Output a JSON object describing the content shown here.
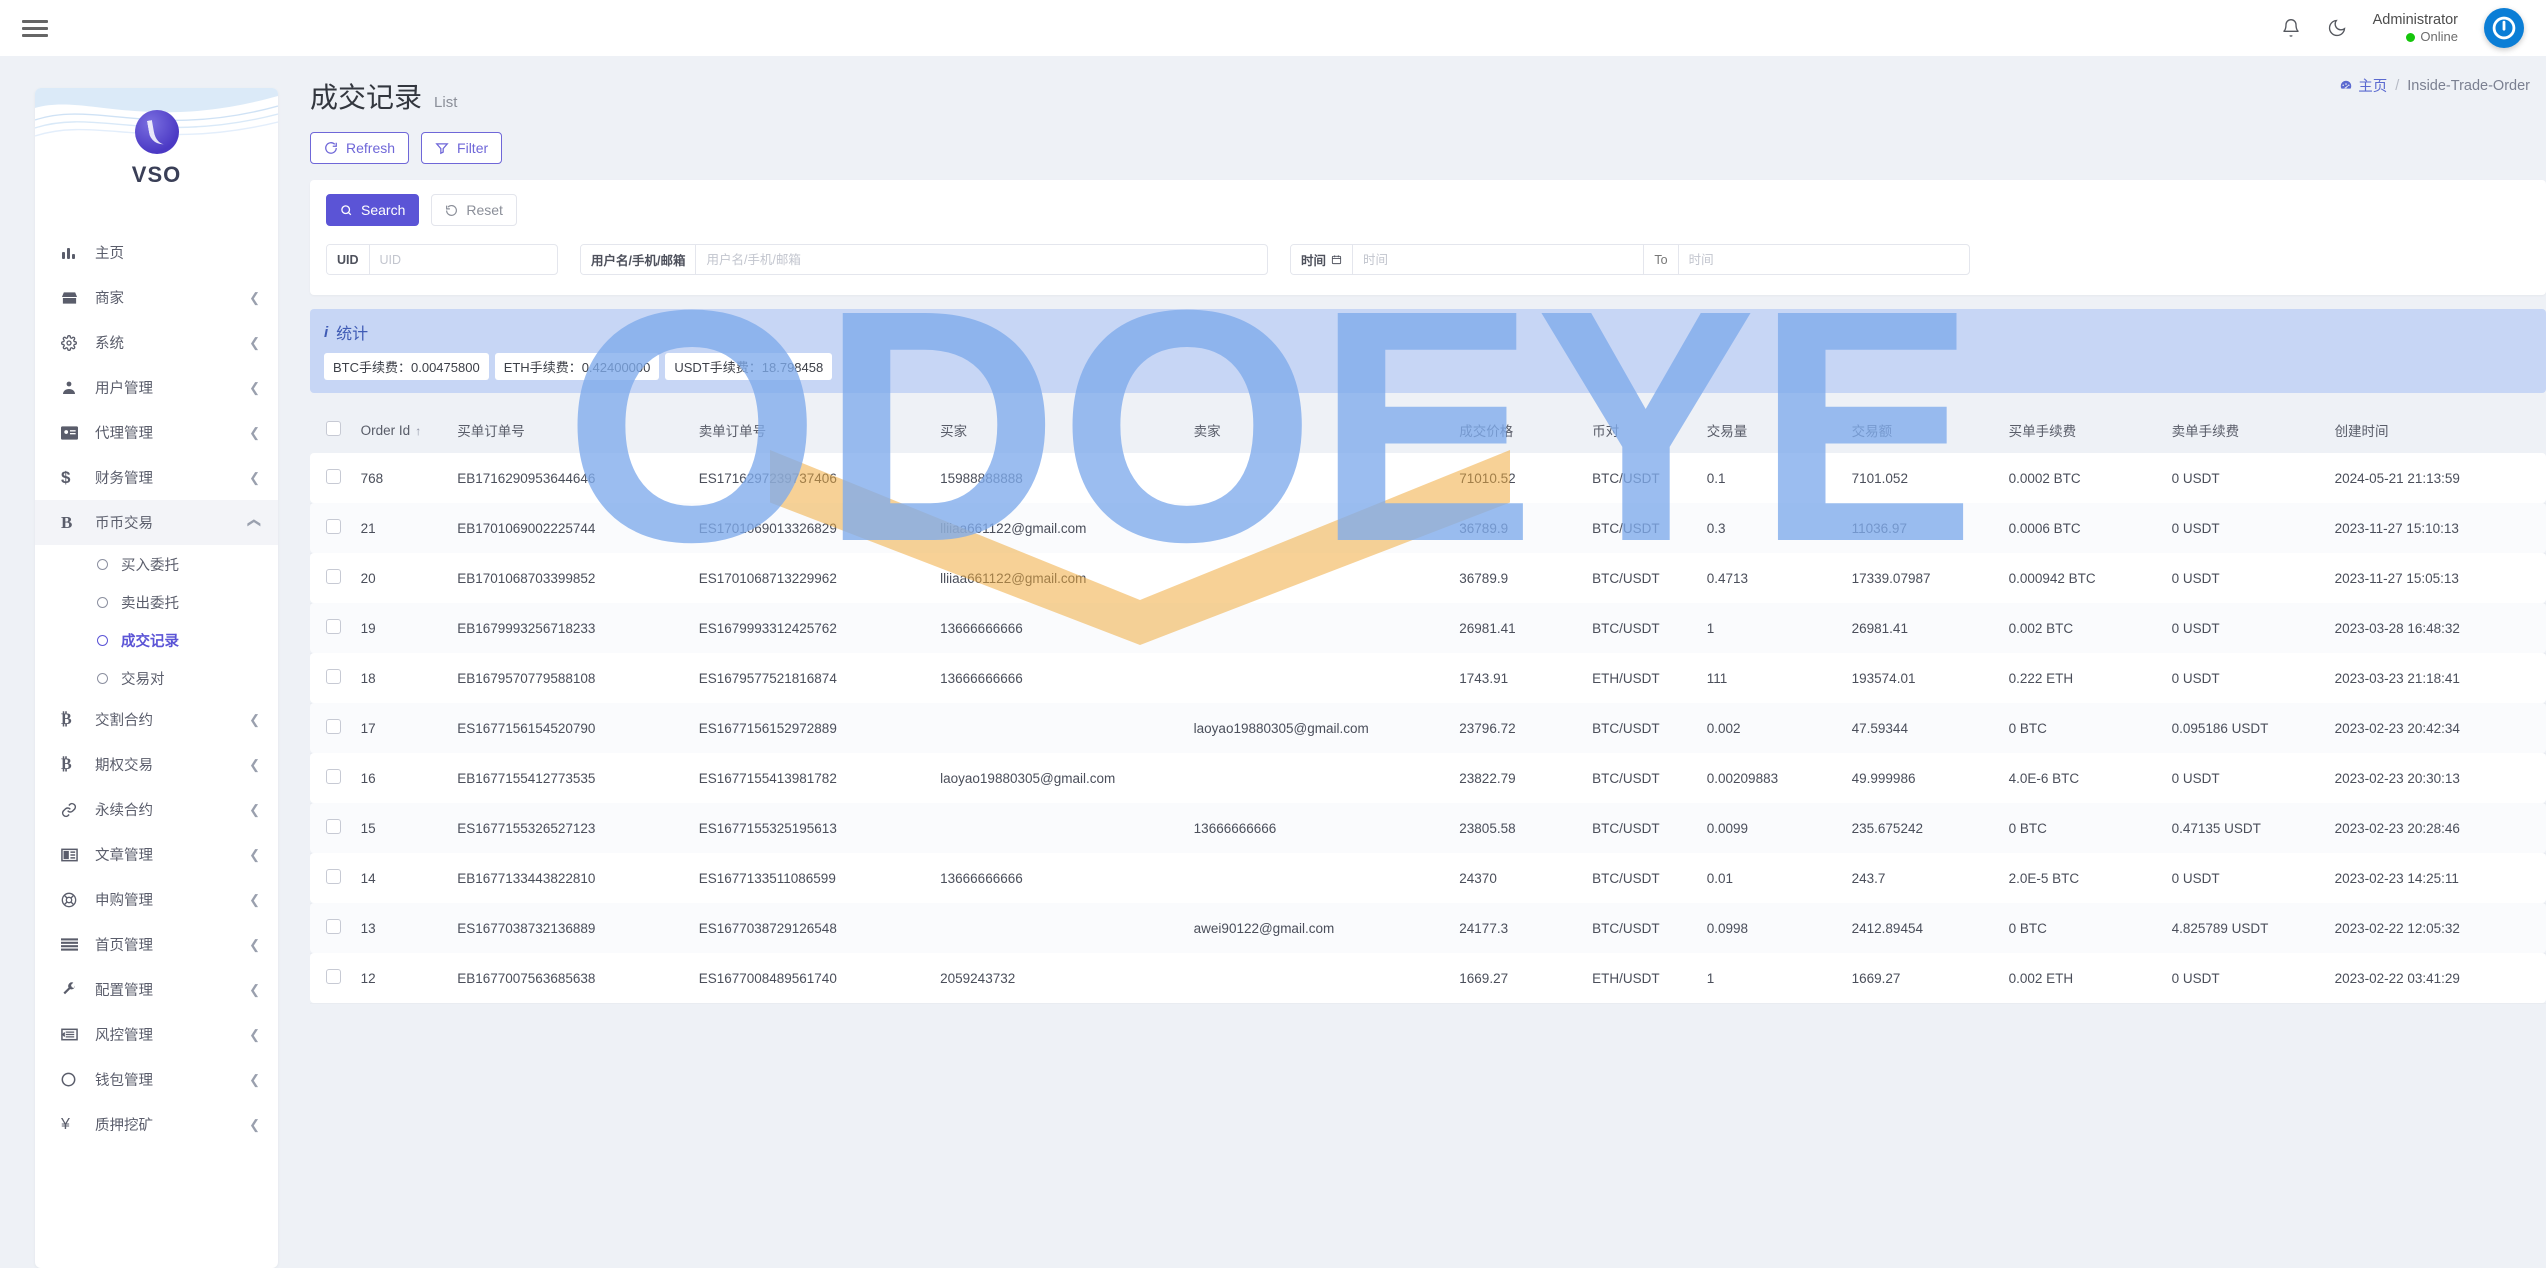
{
  "topbar": {
    "menu_icon": "hamburger-icon",
    "bell_icon": "bell-icon",
    "moon_icon": "moon-icon",
    "user_name": "Administrator",
    "user_status": "Online"
  },
  "sidebar": {
    "brand": "VSO",
    "items": [
      {
        "label": "主页",
        "icon": "bar-chart-icon",
        "expandable": false
      },
      {
        "label": "商家",
        "icon": "merchant-icon",
        "expandable": true
      },
      {
        "label": "系统",
        "icon": "gear-icon",
        "expandable": true
      },
      {
        "label": "用户管理",
        "icon": "users-icon",
        "expandable": true
      },
      {
        "label": "代理管理",
        "icon": "id-card-icon",
        "expandable": true
      },
      {
        "label": "财务管理",
        "icon": "dollar-icon",
        "expandable": true
      },
      {
        "label": "币币交易",
        "icon": "bitcoin-b-icon",
        "expandable": true,
        "expanded": true
      },
      {
        "label": "交割合约",
        "icon": "bitcoin-icon",
        "expandable": true
      },
      {
        "label": "期权交易",
        "icon": "bitcoin-icon",
        "expandable": true
      },
      {
        "label": "永续合约",
        "icon": "link-icon",
        "expandable": true
      },
      {
        "label": "文章管理",
        "icon": "article-icon",
        "expandable": true
      },
      {
        "label": "申购管理",
        "icon": "lifebuoy-icon",
        "expandable": true
      },
      {
        "label": "首页管理",
        "icon": "list-icon",
        "expandable": true
      },
      {
        "label": "配置管理",
        "icon": "wrench-icon",
        "expandable": true
      },
      {
        "label": "风控管理",
        "icon": "risk-icon",
        "expandable": true
      },
      {
        "label": "钱包管理",
        "icon": "circle-icon",
        "expandable": true
      },
      {
        "label": "质押挖矿",
        "icon": "yen-icon",
        "expandable": true
      }
    ],
    "sub_items": [
      {
        "label": "买入委托",
        "selected": false
      },
      {
        "label": "卖出委托",
        "selected": false
      },
      {
        "label": "成交记录",
        "selected": true
      },
      {
        "label": "交易对",
        "selected": false
      }
    ]
  },
  "page": {
    "title": "成交记录",
    "subtitle": "List",
    "breadcrumb_home": "主页",
    "breadcrumb_sep": "/",
    "breadcrumb_current": "Inside-Trade-Order",
    "refresh_label": "Refresh",
    "filter_label": "Filter"
  },
  "search": {
    "search_label": "Search",
    "reset_label": "Reset",
    "uid_label": "UID",
    "uid_placeholder": "UID",
    "uid_value": "",
    "user_label": "用户名/手机/邮箱",
    "user_placeholder": "用户名/手机/邮箱",
    "user_value": "",
    "date_label": "时间",
    "date_from_placeholder": "时间",
    "date_from_value": "",
    "date_to_separator": "To",
    "date_to_placeholder": "时间",
    "date_to_value": ""
  },
  "stats": {
    "title": "统计",
    "chips": [
      "BTC手续费：0.00475800",
      "ETH手续费：0.42400000",
      "USDT手续费：18.798458"
    ]
  },
  "table": {
    "columns": [
      "Order Id",
      "买单订单号",
      "卖单订单号",
      "买家",
      "卖家",
      "成交价格",
      "币对",
      "交易量",
      "交易额",
      "买单手续费",
      "卖单手续费",
      "创建时间"
    ],
    "rows": [
      {
        "id": "768",
        "buy_order": "EB1716290953644646",
        "sell_order": "ES1716297239737406",
        "buyer": "15988888888",
        "seller": "",
        "price": "71010.52",
        "pair": "BTC/USDT",
        "volume": "0.1",
        "amount": "7101.052",
        "buy_fee": "0.0002 BTC",
        "sell_fee": "0 USDT",
        "created": "2024-05-21 21:13:59"
      },
      {
        "id": "21",
        "buy_order": "EB1701069002225744",
        "sell_order": "ES1701069013326829",
        "buyer": "lliiaa661122@gmail.com",
        "seller": "",
        "price": "36789.9",
        "pair": "BTC/USDT",
        "volume": "0.3",
        "amount": "11036.97",
        "buy_fee": "0.0006 BTC",
        "sell_fee": "0 USDT",
        "created": "2023-11-27 15:10:13"
      },
      {
        "id": "20",
        "buy_order": "EB1701068703399852",
        "sell_order": "ES1701068713229962",
        "buyer": "lliiaa661122@gmail.com",
        "seller": "",
        "price": "36789.9",
        "pair": "BTC/USDT",
        "volume": "0.4713",
        "amount": "17339.07987",
        "buy_fee": "0.000942 BTC",
        "sell_fee": "0 USDT",
        "created": "2023-11-27 15:05:13"
      },
      {
        "id": "19",
        "buy_order": "EB1679993256718233",
        "sell_order": "ES1679993312425762",
        "buyer": "13666666666",
        "seller": "",
        "price": "26981.41",
        "pair": "BTC/USDT",
        "volume": "1",
        "amount": "26981.41",
        "buy_fee": "0.002 BTC",
        "sell_fee": "0 USDT",
        "created": "2023-03-28 16:48:32"
      },
      {
        "id": "18",
        "buy_order": "EB1679570779588108",
        "sell_order": "ES1679577521816874",
        "buyer": "13666666666",
        "seller": "",
        "price": "1743.91",
        "pair": "ETH/USDT",
        "volume": "111",
        "amount": "193574.01",
        "buy_fee": "0.222 ETH",
        "sell_fee": "0 USDT",
        "created": "2023-03-23 21:18:41"
      },
      {
        "id": "17",
        "buy_order": "ES1677156154520790",
        "sell_order": "ES1677156152972889",
        "buyer": "",
        "seller": "laoyao19880305@gmail.com",
        "price": "23796.72",
        "pair": "BTC/USDT",
        "volume": "0.002",
        "amount": "47.59344",
        "buy_fee": "0 BTC",
        "sell_fee": "0.095186 USDT",
        "created": "2023-02-23 20:42:34"
      },
      {
        "id": "16",
        "buy_order": "EB1677155412773535",
        "sell_order": "ES1677155413981782",
        "buyer": "laoyao19880305@gmail.com",
        "seller": "",
        "price": "23822.79",
        "pair": "BTC/USDT",
        "volume": "0.00209883",
        "amount": "49.999986",
        "buy_fee": "4.0E-6 BTC",
        "sell_fee": "0 USDT",
        "created": "2023-02-23 20:30:13"
      },
      {
        "id": "15",
        "buy_order": "ES1677155326527123",
        "sell_order": "ES1677155325195613",
        "buyer": "",
        "seller": "13666666666",
        "price": "23805.58",
        "pair": "BTC/USDT",
        "volume": "0.0099",
        "amount": "235.675242",
        "buy_fee": "0 BTC",
        "sell_fee": "0.47135 USDT",
        "created": "2023-02-23 20:28:46"
      },
      {
        "id": "14",
        "buy_order": "EB1677133443822810",
        "sell_order": "ES1677133511086599",
        "buyer": "13666666666",
        "seller": "",
        "price": "24370",
        "pair": "BTC/USDT",
        "volume": "0.01",
        "amount": "243.7",
        "buy_fee": "2.0E-5 BTC",
        "sell_fee": "0 USDT",
        "created": "2023-02-23 14:25:11"
      },
      {
        "id": "13",
        "buy_order": "ES1677038732136889",
        "sell_order": "ES1677038729126548",
        "buyer": "",
        "seller": "awei90122@gmail.com",
        "price": "24177.3",
        "pair": "BTC/USDT",
        "volume": "0.0998",
        "amount": "2412.89454",
        "buy_fee": "0 BTC",
        "sell_fee": "4.825789 USDT",
        "created": "2023-02-22 12:05:32"
      },
      {
        "id": "12",
        "buy_order": "EB1677007563685638",
        "sell_order": "ES1677008489561740",
        "buyer": "2059243732",
        "seller": "",
        "price": "1669.27",
        "pair": "ETH/USDT",
        "volume": "1",
        "amount": "1669.27",
        "buy_fee": "0.002 ETH",
        "sell_fee": "0 USDT",
        "created": "2023-02-22 03:41:29"
      }
    ]
  },
  "watermark": {
    "text": "ODOEYE",
    "color": "#80acec",
    "accent_color": "#f5bd63"
  },
  "colors": {
    "primary": "#5b54d6",
    "page_bg": "#eef1f6",
    "stats_bg": "#c7d6f5",
    "online": "#16c60c"
  }
}
